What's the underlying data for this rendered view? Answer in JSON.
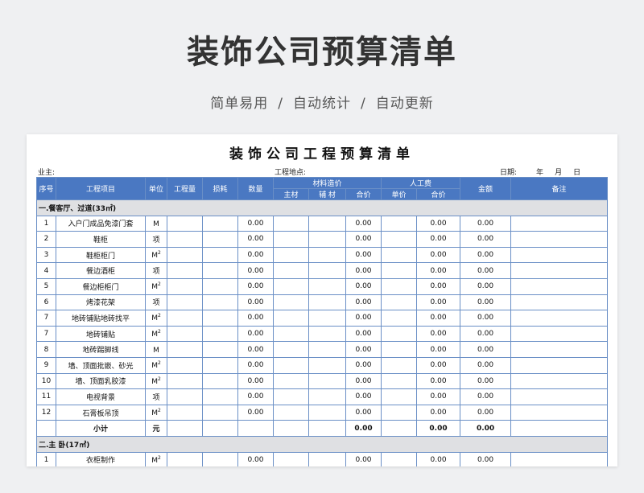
{
  "hero": {
    "title": "装饰公司预算清单",
    "subtitle_parts": [
      "简单易用",
      "自动统计",
      "自动更新"
    ],
    "separator": "/"
  },
  "sheet": {
    "title": "装饰公司工程预算清单",
    "meta": {
      "owner_label": "业主:",
      "site_label": "工程地点:",
      "date_label": "日期:",
      "year": "年",
      "month": "月",
      "day": "日"
    },
    "headers": {
      "seq": "序号",
      "item": "工程项目",
      "unit": "单位",
      "qty": "工程量",
      "loss": "损耗",
      "count": "数量",
      "material": "材料造价",
      "main_material": "主材",
      "aux_material": "辅 材",
      "material_total": "合价",
      "labor": "人工费",
      "labor_unit": "单价",
      "labor_total": "合价",
      "amount": "金额",
      "note": "备注"
    },
    "section1": "一.餐客厅、过道(33㎡)",
    "rows": [
      {
        "seq": "1",
        "item": "入户门成品免漆门套",
        "unit": "M",
        "sup": "",
        "count": "0.00",
        "mat_total": "0.00",
        "labor_total": "0.00",
        "amount": "0.00"
      },
      {
        "seq": "2",
        "item": "鞋柜",
        "unit": "项",
        "sup": "",
        "count": "0.00",
        "mat_total": "0.00",
        "labor_total": "0.00",
        "amount": "0.00"
      },
      {
        "seq": "3",
        "item": "鞋柜柜门",
        "unit": "M",
        "sup": "2",
        "count": "0.00",
        "mat_total": "0.00",
        "labor_total": "0.00",
        "amount": "0.00"
      },
      {
        "seq": "4",
        "item": "餐边酒柜",
        "unit": "项",
        "sup": "",
        "count": "0.00",
        "mat_total": "0.00",
        "labor_total": "0.00",
        "amount": "0.00"
      },
      {
        "seq": "5",
        "item": "餐边柜柜门",
        "unit": "M",
        "sup": "2",
        "count": "0.00",
        "mat_total": "0.00",
        "labor_total": "0.00",
        "amount": "0.00"
      },
      {
        "seq": "6",
        "item": "烤漆花架",
        "unit": "项",
        "sup": "",
        "count": "0.00",
        "mat_total": "0.00",
        "labor_total": "0.00",
        "amount": "0.00"
      },
      {
        "seq": "7",
        "item": "地砖铺贴地砖找平",
        "unit": "M",
        "sup": "2",
        "count": "0.00",
        "mat_total": "0.00",
        "labor_total": "0.00",
        "amount": "0.00"
      },
      {
        "seq": "7",
        "item": "地砖铺贴",
        "unit": "M",
        "sup": "2",
        "count": "0.00",
        "mat_total": "0.00",
        "labor_total": "0.00",
        "amount": "0.00"
      },
      {
        "seq": "8",
        "item": "地砖踢脚线",
        "unit": "M",
        "sup": "",
        "count": "0.00",
        "mat_total": "0.00",
        "labor_total": "0.00",
        "amount": "0.00"
      },
      {
        "seq": "9",
        "item": "墙、顶面批嵌、砂光",
        "unit": "M",
        "sup": "2",
        "count": "0.00",
        "mat_total": "0.00",
        "labor_total": "0.00",
        "amount": "0.00"
      },
      {
        "seq": "10",
        "item": "墙、顶面乳胶漆",
        "unit": "M",
        "sup": "2",
        "count": "0.00",
        "mat_total": "0.00",
        "labor_total": "0.00",
        "amount": "0.00"
      },
      {
        "seq": "11",
        "item": "电视背景",
        "unit": "项",
        "sup": "",
        "count": "0.00",
        "mat_total": "0.00",
        "labor_total": "0.00",
        "amount": "0.00"
      },
      {
        "seq": "12",
        "item": "石膏板吊顶",
        "unit": "M",
        "sup": "2",
        "count": "0.00",
        "mat_total": "0.00",
        "labor_total": "0.00",
        "amount": "0.00"
      }
    ],
    "subtotal": {
      "label": "小计",
      "unit": "元",
      "mat_total": "0.00",
      "labor_total": "0.00",
      "amount": "0.00"
    },
    "section2": "二.主 卧(17㎡)",
    "row2": {
      "seq": "1",
      "item": "衣柜制作",
      "unit": "M",
      "sup": "2",
      "count": "0.00",
      "mat_total": "0.00",
      "labor_total": "0.00",
      "amount": "0.00"
    }
  }
}
